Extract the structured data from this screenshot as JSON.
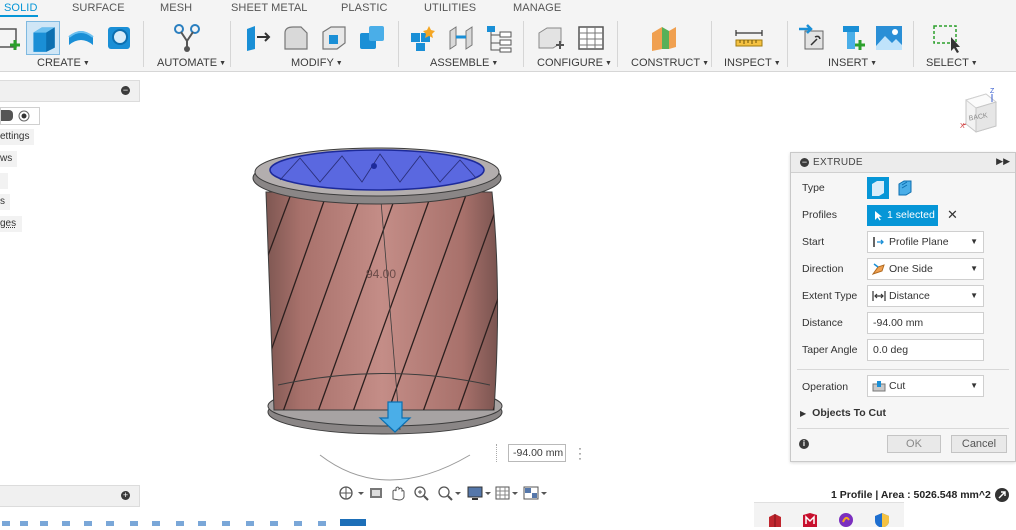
{
  "tabs": [
    {
      "label": "SOLID",
      "active": true
    },
    {
      "label": "SURFACE"
    },
    {
      "label": "MESH"
    },
    {
      "label": "SHEET METAL"
    },
    {
      "label": "PLASTIC"
    },
    {
      "label": "UTILITIES"
    },
    {
      "label": "MANAGE"
    }
  ],
  "toolbar": {
    "groups": [
      "CREATE",
      "AUTOMATE",
      "MODIFY",
      "ASSEMBLE",
      "CONFIGURE",
      "CONSTRUCT",
      "INSPECT",
      "INSERT",
      "SELECT"
    ]
  },
  "browser": {
    "rows": [
      "ettings",
      "ws",
      "s",
      "ges"
    ]
  },
  "viewcube": {
    "face": "BACK",
    "axis_z": "Z",
    "axis_x": "X"
  },
  "viewport": {
    "dimension_label": "94.00",
    "distance_input": "-94.00 mm"
  },
  "extrude": {
    "title": "EXTRUDE",
    "type_label": "Type",
    "profiles_label": "Profiles",
    "profiles_value": "1 selected",
    "start_label": "Start",
    "start_value": "Profile Plane",
    "direction_label": "Direction",
    "direction_value": "One Side",
    "extent_label": "Extent Type",
    "extent_value": "Distance",
    "distance_label": "Distance",
    "distance_value": "-94.00 mm",
    "taper_label": "Taper Angle",
    "taper_value": "0.0 deg",
    "operation_label": "Operation",
    "operation_value": "Cut",
    "objects_label": "Objects To Cut",
    "ok_label": "OK",
    "cancel_label": "Cancel"
  },
  "status": {
    "text": "1 Profile | Area : 5026.548 mm^2"
  },
  "colors": {
    "accent": "#0696d7",
    "body": "#b9817c",
    "cap": "#5566dd"
  }
}
